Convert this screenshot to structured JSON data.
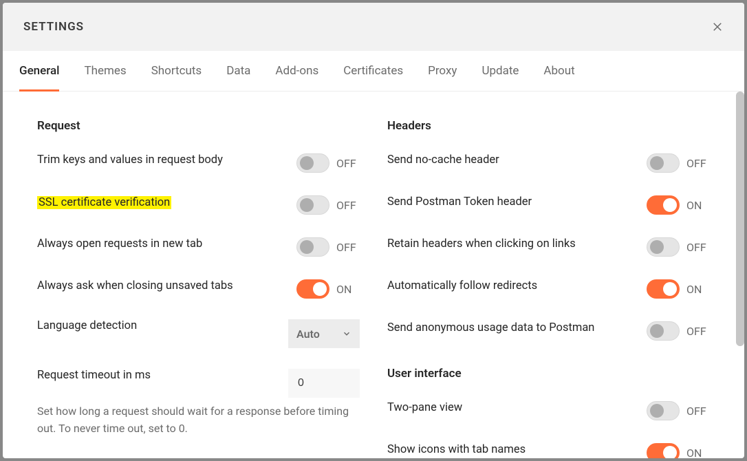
{
  "title": "SETTINGS",
  "tabs": [
    {
      "label": "General",
      "id": "general",
      "active": true
    },
    {
      "label": "Themes",
      "id": "themes",
      "active": false
    },
    {
      "label": "Shortcuts",
      "id": "shortcuts",
      "active": false
    },
    {
      "label": "Data",
      "id": "data",
      "active": false
    },
    {
      "label": "Add-ons",
      "id": "addons",
      "active": false
    },
    {
      "label": "Certificates",
      "id": "certificates",
      "active": false
    },
    {
      "label": "Proxy",
      "id": "proxy",
      "active": false
    },
    {
      "label": "Update",
      "id": "update",
      "active": false
    },
    {
      "label": "About",
      "id": "about",
      "active": false
    }
  ],
  "toggle_labels": {
    "on": "ON",
    "off": "OFF"
  },
  "left": {
    "section": "Request",
    "rows": [
      {
        "label": "Trim keys and values in request body",
        "on": false,
        "highlight": false
      },
      {
        "label": "SSL certificate verification",
        "on": false,
        "highlight": true
      },
      {
        "label": "Always open requests in new tab",
        "on": false,
        "highlight": false
      },
      {
        "label": "Always ask when closing unsaved tabs",
        "on": true,
        "highlight": false
      }
    ],
    "lang_label": "Language detection",
    "lang_value": "Auto",
    "timeout_label": "Request timeout in ms",
    "timeout_value": "0",
    "timeout_desc": "Set how long a request should wait for a response before timing out. To never time out, set to 0."
  },
  "right": {
    "section_headers": "Headers",
    "header_rows": [
      {
        "label": "Send no-cache header",
        "on": false
      },
      {
        "label": "Send Postman Token header",
        "on": true
      },
      {
        "label": "Retain headers when clicking on links",
        "on": false
      },
      {
        "label": "Automatically follow redirects",
        "on": true
      },
      {
        "label": "Send anonymous usage data to Postman",
        "on": false
      }
    ],
    "section_ui": "User interface",
    "ui_rows": [
      {
        "label": "Two-pane view",
        "on": false
      },
      {
        "label": "Show icons with tab names",
        "on": true
      }
    ]
  }
}
